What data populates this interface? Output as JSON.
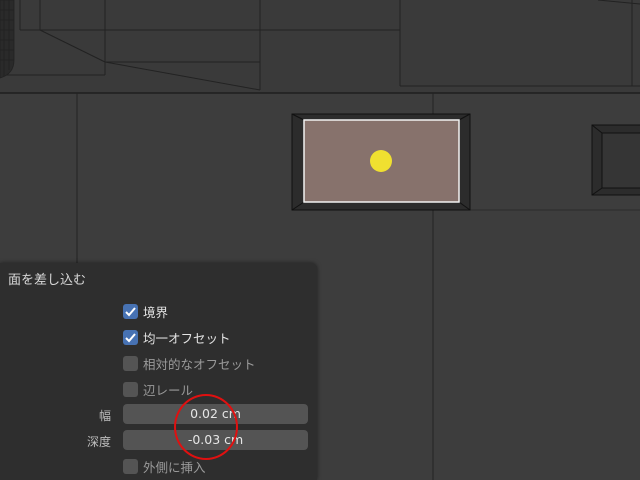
{
  "operator_panel": {
    "title": "面を差し込む",
    "options": [
      {
        "label": "境界",
        "checked": true,
        "enabled": true
      },
      {
        "label": "均一オフセット",
        "checked": true,
        "enabled": true
      },
      {
        "label": "相対的なオフセット",
        "checked": false,
        "enabled": false
      },
      {
        "label": "辺レール",
        "checked": false,
        "enabled": false
      }
    ],
    "thickness": {
      "label": "幅",
      "value": "0.02 cm"
    },
    "depth": {
      "label": "深度",
      "value": "-0.03 cm"
    },
    "outset": {
      "label": "外側に挿入",
      "checked": false
    }
  },
  "colors": {
    "viewport_bg": "#3d3d3d",
    "panel_bg": "#2e2e2e",
    "checkbox_checked": "#4772b3",
    "selected_face": "#87726c",
    "highlight": "#e01010",
    "vertex_dot": "#f0e030"
  }
}
